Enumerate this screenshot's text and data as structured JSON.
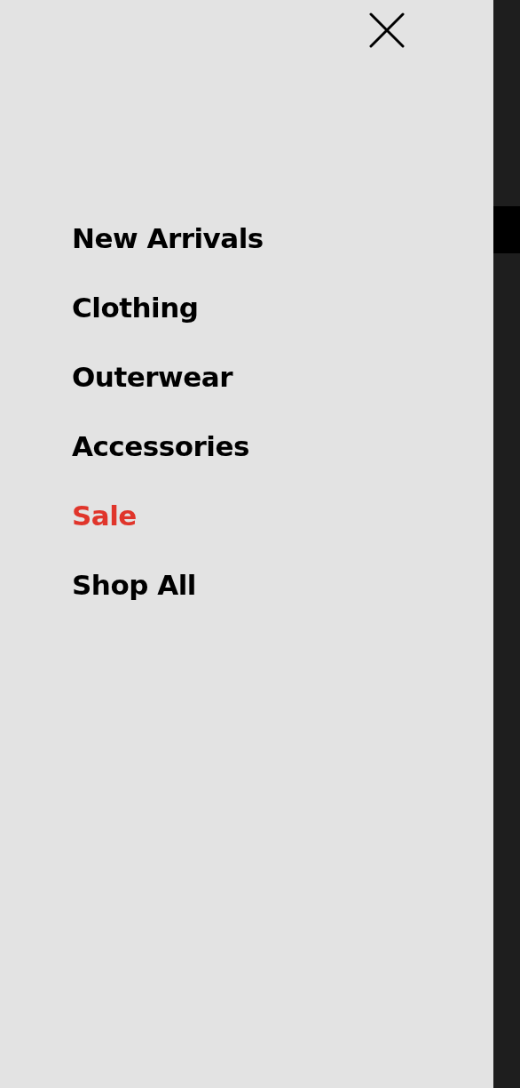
{
  "menu": {
    "items": [
      {
        "label": "New Arrivals",
        "highlighted": false
      },
      {
        "label": "Clothing",
        "highlighted": false
      },
      {
        "label": "Outerwear",
        "highlighted": false
      },
      {
        "label": "Accessories",
        "highlighted": false
      },
      {
        "label": "Sale",
        "highlighted": true
      },
      {
        "label": "Shop All",
        "highlighted": false
      }
    ]
  }
}
